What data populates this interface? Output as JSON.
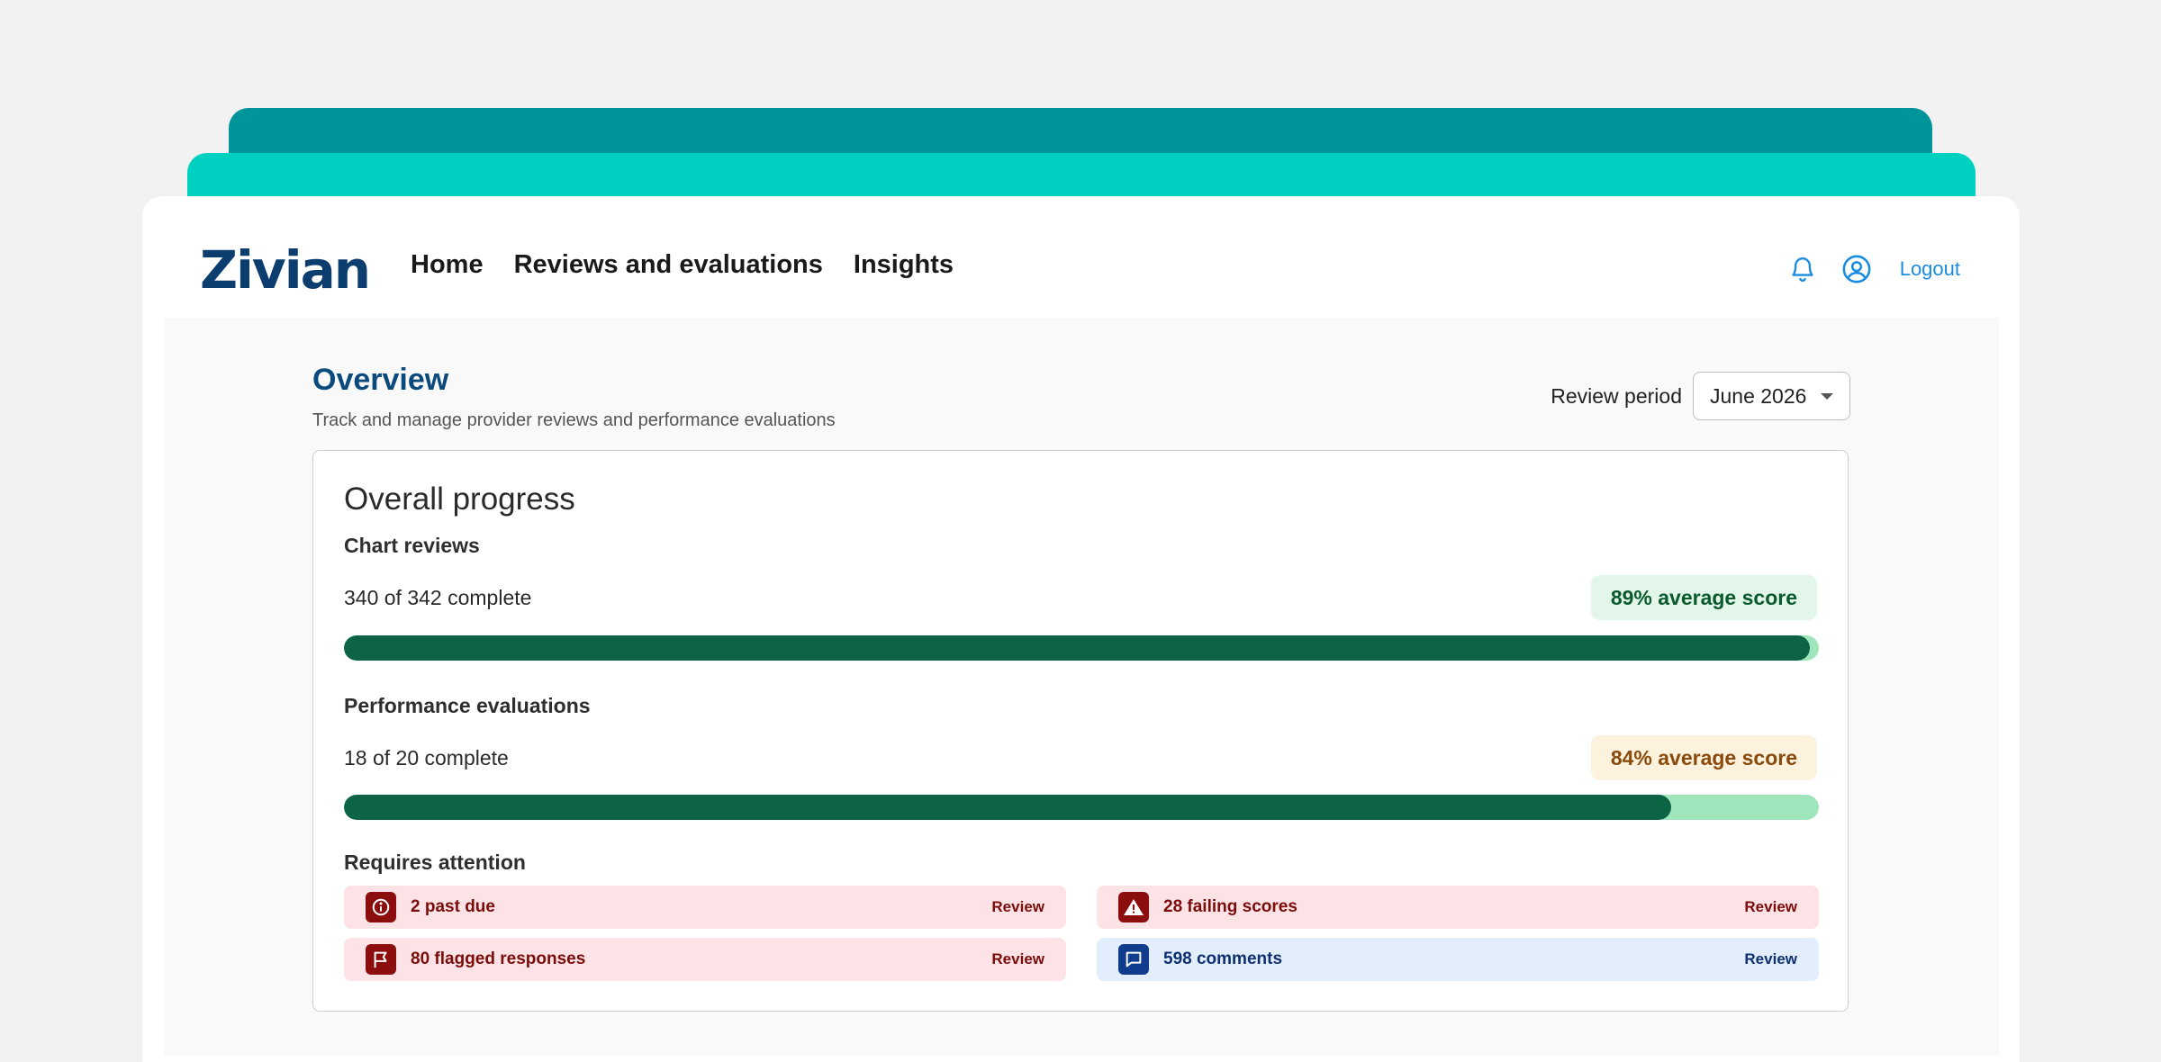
{
  "app": {
    "logo": "Zivian"
  },
  "nav": {
    "items": [
      {
        "label": "Home"
      },
      {
        "label": "Reviews and evaluations"
      },
      {
        "label": "Insights"
      }
    ]
  },
  "header_actions": {
    "notifications_icon": "bell-icon",
    "profile_icon": "user-circle-icon",
    "logout_label": "Logout"
  },
  "page": {
    "title": "Overview",
    "subtitle": "Track and manage provider reviews and performance evaluations",
    "review_period": {
      "label": "Review period",
      "selected": "June 2026"
    }
  },
  "progress": {
    "title": "Overall progress",
    "chart_reviews": {
      "label": "Chart reviews",
      "count_text": "340 of 342 complete",
      "completed": 340,
      "total": 342,
      "score_label": "89% average score"
    },
    "performance_evaluations": {
      "label": "Performance evaluations",
      "count_text": "18 of 20 complete",
      "completed": 18,
      "total": 20,
      "score_label": "84% average score"
    }
  },
  "attention": {
    "title": "Requires attention",
    "items": [
      {
        "text": "2 past due",
        "link": "Review",
        "icon": "info-icon",
        "tone": "red"
      },
      {
        "text": "28 failing scores",
        "link": "Review",
        "icon": "warning-icon",
        "tone": "red"
      },
      {
        "text": "80 flagged responses",
        "link": "Review",
        "icon": "flag-icon",
        "tone": "red"
      },
      {
        "text": "598 comments",
        "link": "Review",
        "icon": "comment-icon",
        "tone": "blue"
      }
    ]
  },
  "colors": {
    "brand_dark": "#0b3d6e",
    "teal_back": "#00959a",
    "teal_front": "#00d0c0",
    "progress_fill": "#0d6444",
    "progress_track": "#9fe6bd",
    "link_blue": "#1a8ce0"
  }
}
